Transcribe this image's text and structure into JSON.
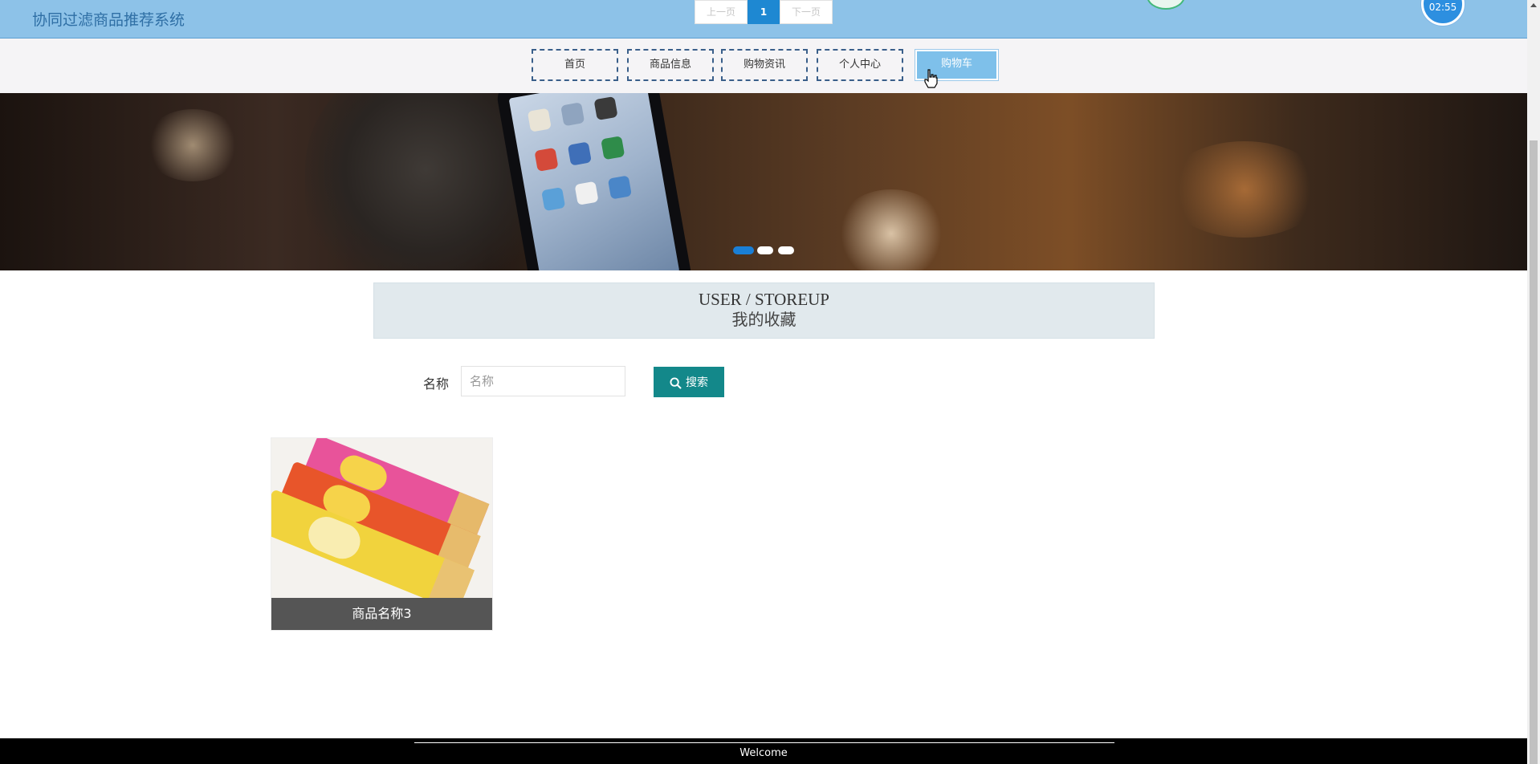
{
  "header": {
    "site_title": "协同过滤商品推荐系统",
    "clock_time": "02:55"
  },
  "nav": {
    "items": [
      {
        "label": "首页",
        "active": false
      },
      {
        "label": "商品信息",
        "active": false
      },
      {
        "label": "购物资讯",
        "active": false
      },
      {
        "label": "个人中心",
        "active": false
      },
      {
        "label": "购物车",
        "active": true
      }
    ]
  },
  "banner": {
    "slide_count": 3,
    "active_slide": 1,
    "colors": {
      "active_dot": "#1a7fd6",
      "inactive_dot": "#ffffff"
    }
  },
  "section": {
    "title_en": "USER / STOREUP",
    "title_cn": "我的收藏"
  },
  "search": {
    "label": "名称",
    "placeholder": "名称",
    "value": "",
    "button_label": "搜索",
    "button_icon": "search-icon"
  },
  "products": [
    {
      "name": "商品名称3",
      "image": "potato-chips-cans-photo"
    }
  ],
  "pagination": {
    "prev_label": "上一页",
    "current_page": "1",
    "next_label": "下一页"
  },
  "footer": {
    "text": "Welcome"
  },
  "colors": {
    "header_bg": "#8dc2e8",
    "nav_active_bg": "#7ec0ea",
    "search_button_bg": "#13888a",
    "caption_bg": "#555555",
    "pager_active": "#1e88d2",
    "footer_bg": "#000000"
  }
}
